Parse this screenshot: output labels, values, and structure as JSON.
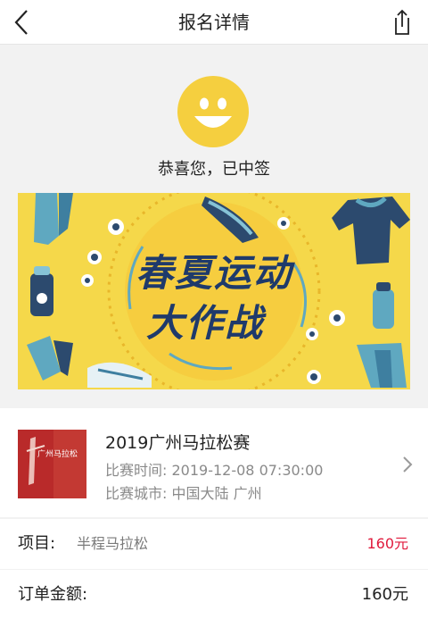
{
  "header": {
    "title": "报名详情",
    "back_icon": "chevron-left-icon",
    "share_icon": "share-icon"
  },
  "hero": {
    "message": "恭喜您，已中签",
    "banner_line1": "春夏运动",
    "banner_line2": "大作战",
    "colors": {
      "banner_bg": "#f5d84a",
      "banner_text": "#1f3a6b",
      "smiley": "#f5cf3f"
    }
  },
  "event": {
    "name": "2019广州马拉松赛",
    "time_label": "比赛时间:",
    "time_value": "2019-12-08 07:30:00",
    "city_label": "比赛城市:",
    "city_value": "中国大陆 广州",
    "thumb_text": "广州马拉松"
  },
  "item_row": {
    "label": "项目:",
    "value": "半程马拉松",
    "price": "160元"
  },
  "amount_row": {
    "label": "订单金额:",
    "price": "160元"
  }
}
